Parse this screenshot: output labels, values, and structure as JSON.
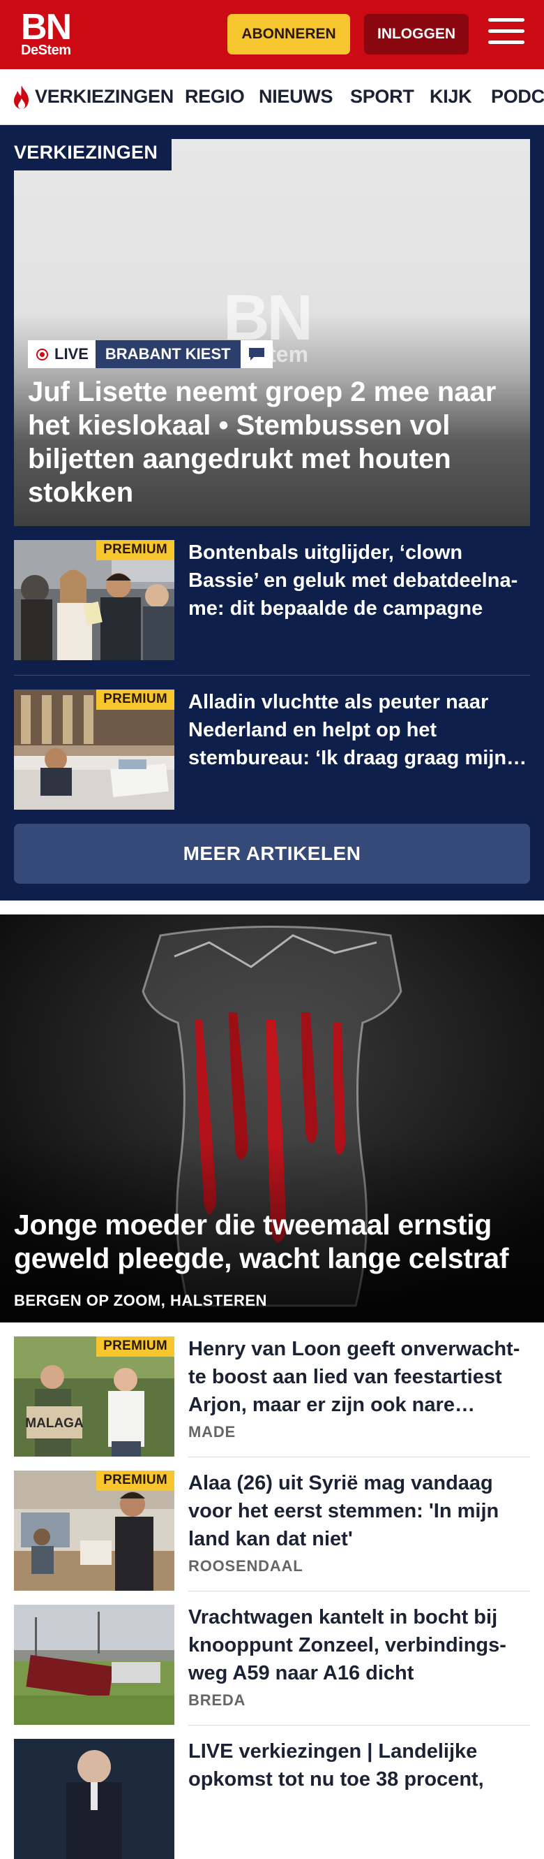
{
  "header": {
    "logo_top": "BN",
    "logo_bottom": "DeStem",
    "subscribe_label": "ABONNEREN",
    "login_label": "INLOGGEN"
  },
  "nav": {
    "items": [
      "VERKIEZINGEN",
      "REGIO",
      "NIEUWS",
      "SPORT",
      "KIJK",
      "PODC"
    ]
  },
  "elections": {
    "section_label": "VERKIEZINGEN",
    "hero": {
      "live_label": "LIVE",
      "tag_label": "BRABANT KIEST",
      "title": "Juf Lisette neemt groep 2 mee naar het kieslokaal • Stembussen vol biljetten aangedrukt met houten stokken",
      "watermark_top": "BN",
      "watermark_bottom": "DeStem"
    },
    "articles": [
      {
        "premium_label": "PREMIUM",
        "title": "Bontenbals uitglijder, ‘clown Bassie’ en geluk met debatdeelna­me: dit bepaalde de campagne"
      },
      {
        "premium_label": "PREMIUM",
        "title": "Alladin vluchtte als peuter naar Nederland en helpt op het stembureau: ‘Ik draag graag mijn…"
      }
    ],
    "more_label": "MEER ARTIKELEN"
  },
  "main_story": {
    "title": "Jonge moeder die tweemaal ernstig geweld pleegde, wacht lange celstraf",
    "location": "BERGEN OP ZOOM, HALSTEREN"
  },
  "articles": [
    {
      "premium_label": "PREMIUM",
      "title": "Henry van Loon geeft onverwacht­te boost aan lied van feestartiest Arjon, maar er zijn ook nare…",
      "location": "MADE",
      "sign_text": "MALAGA"
    },
    {
      "premium_label": "PREMIUM",
      "title": "Alaa (26) uit Syrië mag vandaag voor het eerst stemmen: 'In mijn land kan dat niet'",
      "location": "ROOSENDAAL"
    },
    {
      "title": "Vrachtwagen kantelt in bocht bij knooppunt Zonzeel, verbindings­weg A59 naar A16 dicht",
      "location": "BREDA"
    },
    {
      "title": "LIVE verkiezingen | Landelijke opkomst tot nu toe 38 procent,"
    }
  ],
  "colors": {
    "brand_red": "#cc0a13",
    "navy": "#0d1f4a",
    "premium_yellow": "#f7c52d",
    "more_button": "#354a78"
  },
  "icons": [
    "flame-icon",
    "hamburger-menu-icon",
    "live-dot-icon",
    "chat-bubble-icon"
  ]
}
